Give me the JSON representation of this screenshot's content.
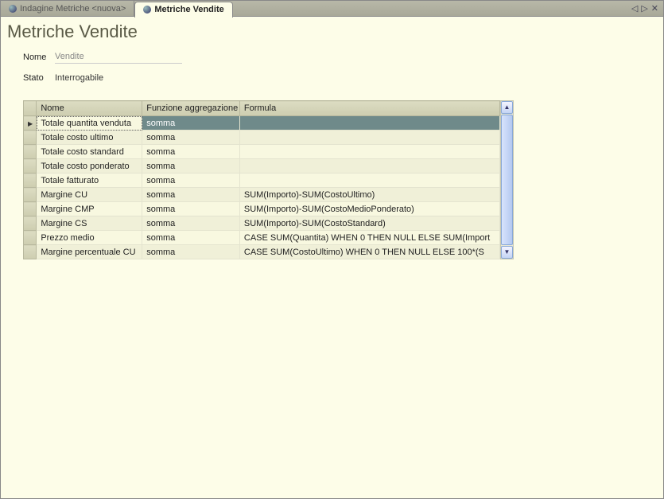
{
  "tabs": [
    {
      "label": "Indagine Metriche <nuova>",
      "active": false
    },
    {
      "label": "Metriche Vendite",
      "active": true
    }
  ],
  "page_title": "Metriche Vendite",
  "form": {
    "nome_label": "Nome",
    "nome_value": "Vendite",
    "stato_label": "Stato",
    "stato_value": "Interrogabile"
  },
  "grid": {
    "headers": {
      "nome": "Nome",
      "func": "Funzione aggregazione",
      "formula": "Formula"
    },
    "rows": [
      {
        "nome": "Totale quantita venduta",
        "func": "somma",
        "formula": "",
        "selected": true
      },
      {
        "nome": "Totale costo ultimo",
        "func": "somma",
        "formula": ""
      },
      {
        "nome": "Totale costo standard",
        "func": "somma",
        "formula": ""
      },
      {
        "nome": "Totale costo ponderato",
        "func": "somma",
        "formula": ""
      },
      {
        "nome": "Totale fatturato",
        "func": "somma",
        "formula": ""
      },
      {
        "nome": "Margine CU",
        "func": "somma",
        "formula": "SUM(Importo)-SUM(CostoUltimo)"
      },
      {
        "nome": "Margine CMP",
        "func": "somma",
        "formula": "SUM(Importo)-SUM(CostoMedioPonderato)"
      },
      {
        "nome": "Margine CS",
        "func": "somma",
        "formula": "SUM(Importo)-SUM(CostoStandard)"
      },
      {
        "nome": "Prezzo medio",
        "func": "somma",
        "formula": "CASE SUM(Quantita) WHEN 0 THEN NULL ELSE SUM(Import"
      },
      {
        "nome": "Margine percentuale CU",
        "func": "somma",
        "formula": "CASE SUM(CostoUltimo) WHEN 0 THEN NULL ELSE 100*(S"
      }
    ]
  },
  "tab_controls": {
    "prev": "◁",
    "next": "▷",
    "close": "✕"
  }
}
